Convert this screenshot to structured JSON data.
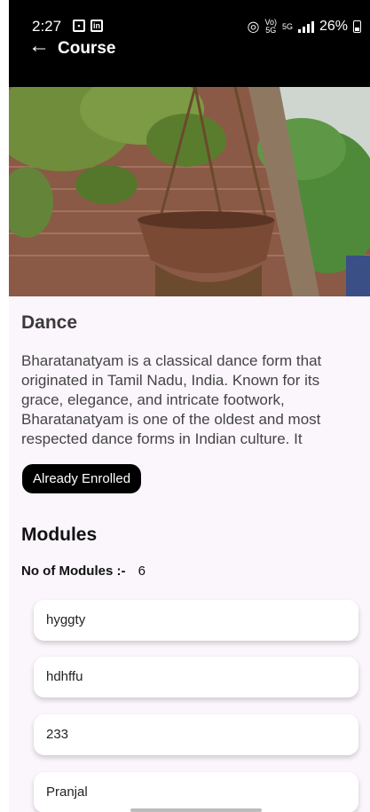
{
  "status_bar": {
    "time": "2:27",
    "left_icons": [
      "image-icon",
      "linkedin-icon"
    ],
    "right_text": "26%",
    "network_5g": "5G",
    "volte": "Vo)) 5G"
  },
  "header": {
    "back_icon": "arrow-left-icon",
    "title": "Course"
  },
  "course": {
    "title": "Dance",
    "description": "Bharatanatyam is a classical dance form that originated in Tamil Nadu, India. Known for its grace, elegance, and intricate footwork, Bharatanatyam is one of the oldest and most respected dance forms in Indian culture. It",
    "enroll_label": "Already Enrolled"
  },
  "modules": {
    "title": "Modules",
    "count_label": "No of Modules :-",
    "count_value": "6",
    "items": [
      {
        "label": "hyggty"
      },
      {
        "label": "hdhffu"
      },
      {
        "label": "233"
      },
      {
        "label": "Pranjal"
      }
    ]
  },
  "colors": {
    "header_bg": "#000000",
    "page_bg": "#fbf6fc",
    "button_bg": "#000000"
  }
}
